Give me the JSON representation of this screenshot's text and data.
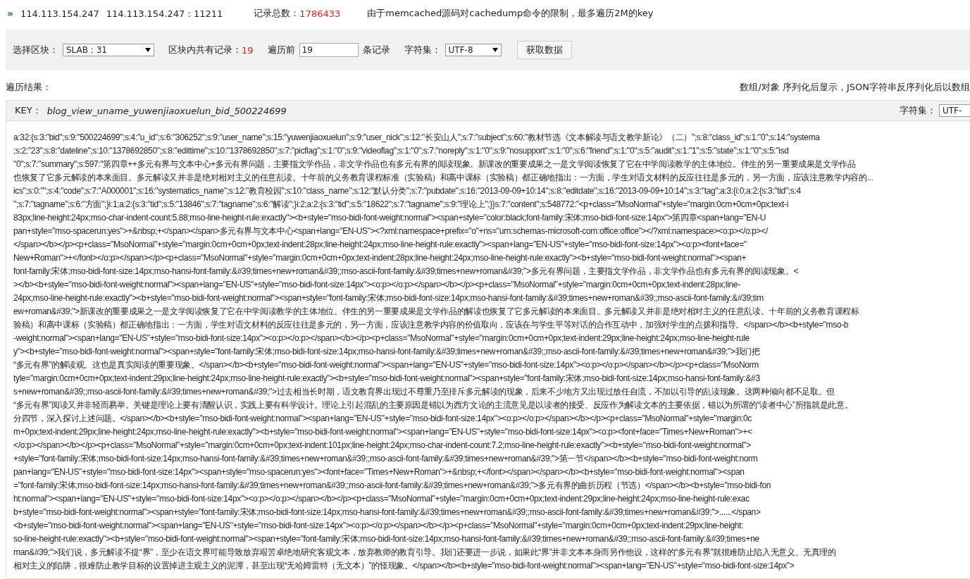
{
  "header": {
    "marker": "»",
    "server": "114.113.154.247",
    "address": "114.113.154.247 : 11211",
    "total_label": "记录总数：",
    "total_value": "1786433",
    "note": "由于memcached源码对cachedump命令的限制，最多遍历2M的key"
  },
  "toolbar": {
    "slab_label": "选择区块：",
    "slab_value": "SLAB : 31",
    "count_label": "区块内共有记录：",
    "count_value": "19",
    "limit_label": "遍历前",
    "limit_value": "19",
    "limit_unit": "条记录",
    "charset_label": "字符集：",
    "charset_value": "UTF-8",
    "fetch_button": "获取数据"
  },
  "result": {
    "label": "遍历结果：",
    "hint": "数组/对象 序列化后显示，JSON字符串反序列化后以数组"
  },
  "entry": {
    "key_label": "KEY：",
    "key": "blog_view_uname_yuwenjiaoxuelun_bid_500224699",
    "charset_label": "字符集：",
    "charset_value": "UTF-",
    "lines": [
      "a:32:{s:3:\"bid\";s:9:\"500224699\";s:4:\"u_id\";s:6:\"306252\";s:9:\"user_name\";s:15:\"yuwenjiaoxuelun\";s:9:\"user_nick\";s:12:\"长安山人\";s:7:\"subject\";s:60:\"教材节选《文本解读与语文教学新论》（二）\";s:8:\"class_id\";s:1:\"0\";s:14:\"systema",
      ";s:2:\"23\";s:8:\"dateline\";s:10:\"1378692850\";s:8:\"edittime\";s:10:\"1378692850\";s:7:\"picflag\";s:1:\"0\";s:9:\"videoflag\";s:1:\"0\";s:7:\"noreply\";s:1:\"0\";s:9:\"nosupport\";s:1:\"0\";s:6:\"friend\";s:1:\"0\";s:5:\"audit\";s:1:\"1\";s:5:\"state\";s:1:\"0\";s:5:\"isd",
      "\"0\";s:7:\"summary\";s:597:\"第四章++多元有界与文本中心+多元有界问题，主要指文学作品，非文学作品也有多元有界的阅读现象。新课改的重要成果之一是文学阅读恢复了它在中学阅读教学的主体地位。伴生的另一重要成果是文学作品",
      "也恢复了它多元解读的本来面目。多元解读又并非是绝对相对主义的任意乱读。十年前的义务教育课程标准（实验稿）和高中课标（实验稿）都正确地指出：一方面，学生对语文材料的反应往往是多元的，另一方面，应该注意教学内容的...",
      "ics\";s:0:\"\";s:4:\"code\";s:7:\"A000001\";s:16:\"systematics_name\";s:12:\"教育校园\";s:10:\"class_name\";s:12:\"默认分类\";s:7:\"pubdate\";s:16:\"2013-09-09+10:14\";s:8:\"editdate\";s:16:\"2013-09-09+10:14\";s:3:\"tag\";a:3:{i:0;a:2:{s:3:\"tid\";s:4",
      "\";s:7:\"tagname\";s:6:\"方面\";}i:1;a:2:{s:3:\"tid\";s:5:\"13846\";s:7:\"tagname\";s:6:\"解读\";}i:2;a:2:{s:3:\"tid\";s:5:\"18622\";s:7:\"tagname\";s:9:\"理论上\";}}s:7:\"content\";s:548772:\"<p+class=\"MsoNormal\"+style=\"margin:0cm+0cm+0px;text-i",
      "83px;line-height:24px;mso-char-indent-count:5.88;mso-line-height-rule:exactly\"><b+style=\"mso-bidi-font-weight:normal\"><span+style=\"color:black;font-family:宋体;mso-bidi-font-size:14px\">第四章<span+lang=\"EN-U",
      "pan+style=\"mso-spacerun:yes\">+&nbsp;+</span></span>多元有界与文本中心<span+lang=\"EN-US\"><?xml:namespace+prefix=\"o\"+ns=\"urn:schemas-microsoft-com:office:office\"></?xml:namespace><o:p></o:p></",
      "</span></b></p><p+class=\"MsoNormal\"+style=\"margin:0cm+0cm+0px;text-indent:28px;line-height:24px;mso-line-height-rule:exactly\"><span+lang=\"EN-US\"+style=\"mso-bidi-font-size:14px\"><o:p><font+face=\"",
      "New+Roman\">+</font></o:p></span></p><p+class=\"MsoNormal\"+style=\"margin:0cm+0cm+0px;text-indent:28px;line-height:24px;mso-line-height-rule:exactly\"><b+style=\"mso-bidi-font-weight:normal\"><span+",
      "font-family:宋体;mso-bidi-font-size:14px;mso-hansi-font-family:&#39;times+new+roman&#39;;mso-ascii-font-family:&#39;times+new+roman&#39;\">多元有界问题，主要指文学作品，非文学作品也有多元有界的阅读现象。<",
      "></b><b+style=\"mso-bidi-font-weight:normal\"><span+lang=\"EN-US\"+style=\"mso-bidi-font-size:14px\"><o:p></o:p></span></b></p><p+class=\"MsoNormal\"+style=\"margin:0cm+0cm+0px;text-indent:28px;line-",
      "24px;mso-line-height-rule:exactly\"><b+style=\"mso-bidi-font-weight:normal\"><span+style=\"font-family:宋体;mso-bidi-font-size:14px;mso-hansi-font-family:&#39;times+new+roman&#39;;mso-ascii-font-family:&#39;tim",
      "ew+roman&#39;\">新课改的重要成果之一是文学阅读恢复了它在中学阅读教学的主体地位。伴生的另一重要成果是文学作品的解读也恢复了它多元解读的本来面目。多元解读又并非是绝对相对主义的任意乱读。十年前的义务教育课程标",
      "验稿）和高中课标（实验稿）都正确地指出：一方面，学生对语文材料的反应往往是多元的，另一方面，应该注意教学内容的价值取向，应该在与学生平等对话的合作互动中，加强对学生的点拨和指导。</span></b><b+style=\"mso-b",
      "-weight:normal\"><span+lang=\"EN-US\"+style=\"mso-bidi-font-size:14px\"><o:p></o:p></span></b></p><p+class=\"MsoNormal\"+style=\"margin:0cm+0cm+0px;text-indent:29px;line-height:24px;mso-line-height-rule",
      "y\"><b+style=\"mso-bidi-font-weight:normal\"><span+style=\"font-family:宋体;mso-bidi-font-size:14px;mso-hansi-font-family:&#39;times+new+roman&#39;;mso-ascii-font-family:&#39;times+new+roman&#39;\">我们把",
      "“多元有界”的解读观。这也是真实阅读的重要现象。</span></b><b+style=\"mso-bidi-font-weight:normal\"><span+lang=\"EN-US\"+style=\"mso-bidi-font-size:14px\"><o:p></o:p></span></b></p><p+class=\"MsoNorm",
      "tyle=\"margin:0cm+0cm+0px;text-indent:29px;line-height:24px;mso-line-height-rule:exactly\"><b+style=\"mso-bidi-font-weight:normal\"><span+style=\"font-family:宋体;mso-bidi-font-size:14px;mso-hansi-font-family:&#3",
      "s+new+roman&#39;;mso-ascii-font-family:&#39;times+new+roman&#39;\">过去相当长时期，语文教育界出现过不尊重乃至排斥多元解读的现象，后来不少地方又出现过放任自流，不加以引导的乱读现象。这两种倾向都不足取。但",
      "“多元有界”阅读又并非轻而易举。关键是理论上要有清醒认识，实践上要有科学设计。理论上引起混乱的主要原因是错以为西方文论的主流意见是以读者的接受、反应作为解读文本的主要依据，错以为所谓的“读者中心”所指就是此意。",
      "分四节，深入探讨上述问题。</span></b><b+style=\"mso-bidi-font-weight:normal\"><span+lang=\"EN-US\"+style=\"mso-bidi-font-size:14px\"><o:p></o:p></span></b></p><p+class=\"MsoNormal\"+style=\"margin:0c",
      "m+0px;text-indent:29px;line-height:24px;mso-line-height-rule:exactly\"><b+style=\"mso-bidi-font-weight:normal\"><span+lang=\"EN-US\"+style=\"mso-bidi-font-size:14px\"><o:p><font+face=\"Times+New+Roman\">+<",
      "</o:p></span></b></p><p+class=\"MsoNormal\"+style=\"margin:0cm+0cm+0px;text-indent:101px;line-height:24px;mso-char-indent-count:7.2;mso-line-height-rule:exactly\"><b+style=\"mso-bidi-font-weight:normal\">",
      "+style=\"font-family:宋体;mso-bidi-font-size:14px;mso-hansi-font-family:&#39;times+new+roman&#39;;mso-ascii-font-family:&#39;times+new+roman&#39;\">第一节</span></b><b+style=\"mso-bidi-font-weight:norm",
      "pan+lang=\"EN-US\"+style=\"mso-bidi-font-size:14px\"><span+style=\"mso-spacerun:yes\"><font+face=\"Times+New+Roman\">+&nbsp;+</font></span></span></b><b+style=\"mso-bidi-font-weight:normal\"><span",
      "=\"font-family:宋体;mso-bidi-font-size:14px;mso-hansi-font-family:&#39;times+new+roman&#39;;mso-ascii-font-family:&#39;times+new+roman&#39;\">多元有界的曲折历程（节选）</span></b><b+style=\"mso-bidi-fon",
      "ht:normal\"><span+lang=\"EN-US\"+style=\"mso-bidi-font-size:14px\"><o:p></o:p></span></b></p><p+class=\"MsoNormal\"+style=\"margin:0cm+0cm+0px;text-indent:29px;line-height:24px;mso-line-height-rule:exac",
      "b+style=\"mso-bidi-font-weight:normal\"><span+style=\"font-family:宋体;mso-bidi-font-size:14px;mso-hansi-font-family:&#39;times+new+roman&#39;;mso-ascii-font-family:&#39;times+new+roman&#39;\">......</span>",
      "<b+style=\"mso-bidi-font-weight:normal\"><span+lang=\"EN-US\"+style=\"mso-bidi-font-size:14px\"><o:p></o:p></span></b></p><p+class=\"MsoNormal\"+style=\"margin:0cm+0cm+0px;text-indent:29px;line-height:",
      "so-line-height-rule:exactly\"><b+style=\"mso-bidi-font-weight:normal\"><span+style=\"font-family:宋体;mso-bidi-font-size:14px;mso-hansi-font-family:&#39;times+new+roman&#39;;mso-ascii-font-family:&#39;times+ne",
      "man&#39;\">我们说，多元解读不提“界”，至少在语文界可能导致放弃艰苦卓绝地研究客观文本，放弃教师的教育引导。我们还要进一步说，如果此“界”并非文本本身而另作他设，这样的“多元有界”就很难防止陷入无意义、无真理的",
      "相对主义的陷阱，很难防止教学目标的设置掉进主观主义的泥潭，甚至出现“无哈姆雷特（无文本）”的怪现象。</span></b><b+style=\"mso-bidi-font-weight:normal\"><span+lang=\"EN-US\"+style=\"mso-bidi-font-size:14px\">"
    ]
  }
}
